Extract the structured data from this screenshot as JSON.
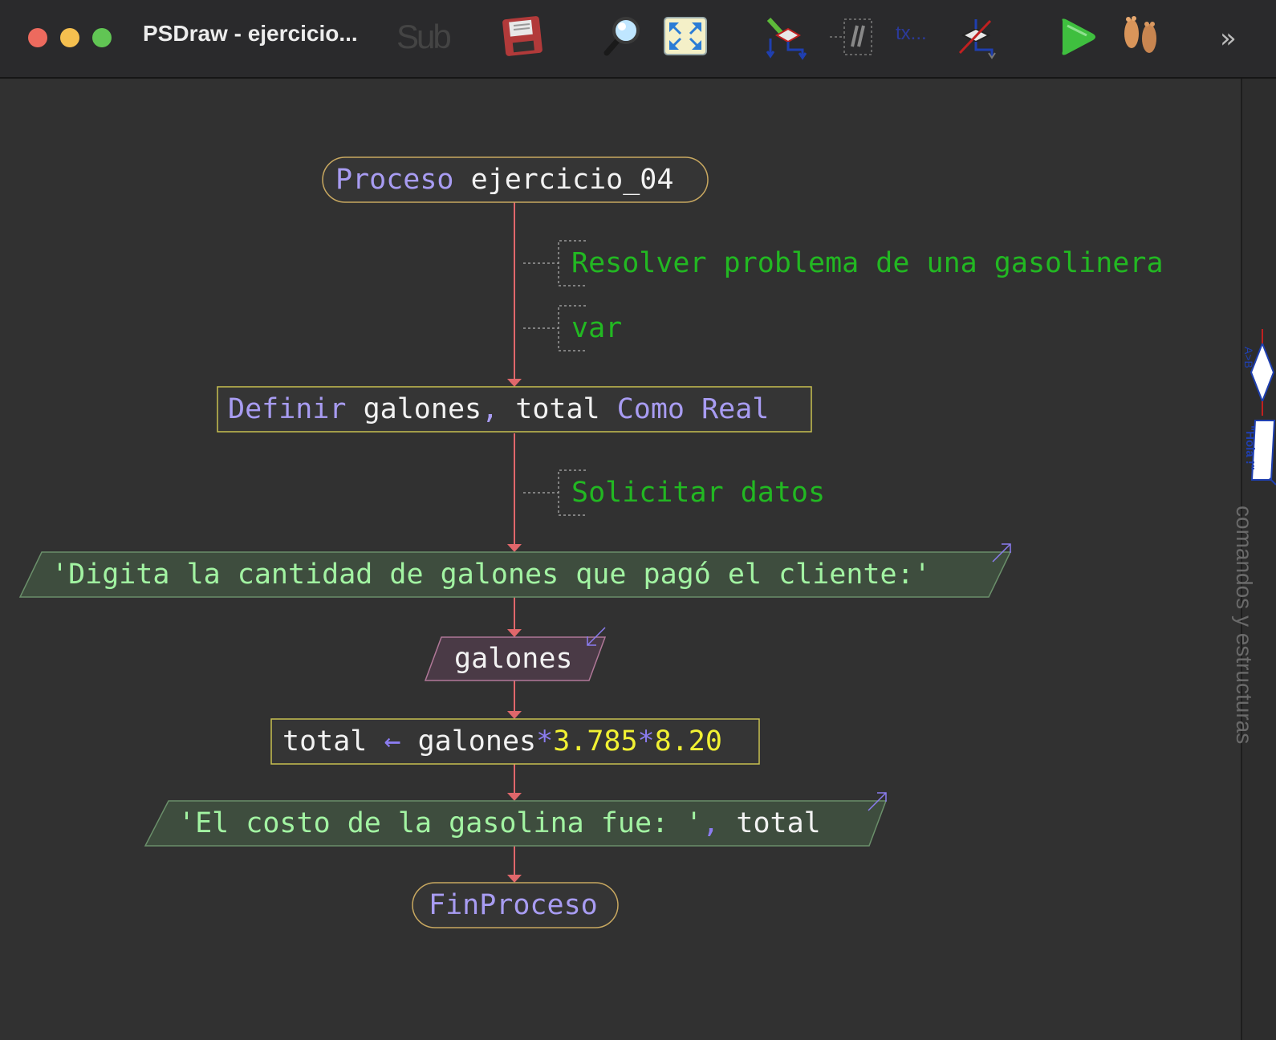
{
  "window": {
    "title": "PSDraw - ejercicio...",
    "traffic_lights": {
      "close_color": "#ed6a5e",
      "minimize_color": "#f5bf4f",
      "maximize_color": "#61c554"
    }
  },
  "toolbar": {
    "items": [
      {
        "name": "sub-icon",
        "label": "Sub"
      },
      {
        "name": "save-icon"
      },
      {
        "name": "zoom-icon"
      },
      {
        "name": "fit-screen-icon"
      },
      {
        "name": "draw-tool-icon"
      },
      {
        "name": "comment-tool-icon"
      },
      {
        "name": "text-tool-icon",
        "label": "tx..."
      },
      {
        "name": "hide-tool-icon"
      },
      {
        "name": "run-icon"
      },
      {
        "name": "step-by-step-icon"
      },
      {
        "name": "overflow-chevron-icon",
        "label": "»"
      }
    ]
  },
  "sidebar": {
    "label": "comandos y estructuras",
    "tabs": [
      {
        "name": "condition-tab",
        "label": "A>B"
      },
      {
        "name": "output-tab",
        "label": "\"Hola !\""
      }
    ]
  },
  "flowchart": {
    "start": {
      "keyword": "Proceso",
      "name": "ejercicio_04"
    },
    "comment1": "Resolver problema de una gasolinera",
    "comment2": "var",
    "define": {
      "keyword": "Definir",
      "vars": "galones",
      "sep": ",",
      "var2": "total",
      "como": "Como",
      "type": "Real"
    },
    "comment3": "Solicitar datos",
    "output1": "'Digita la cantidad de galones que pagó el cliente:'",
    "input1": "galones",
    "assign": {
      "target": "total",
      "arrow": "←",
      "source": "galones",
      "op1": "*",
      "num1": "3.785",
      "op2": "*",
      "num2": "8.20"
    },
    "output2": {
      "string": "'El costo de la gasolina fue: '",
      "sep": ",",
      "var": "total"
    },
    "end": "FinProceso"
  },
  "colors": {
    "flow_line": "#e0676b",
    "terminal_border": "#c8a860",
    "process_border": "#c8c050",
    "output_fill": "#3e4d3e",
    "input_fill": "#4a3a46",
    "keyword": "#a89cf2",
    "string": "#a2f3a2",
    "number": "#f1f133",
    "comment": "#22b822"
  }
}
